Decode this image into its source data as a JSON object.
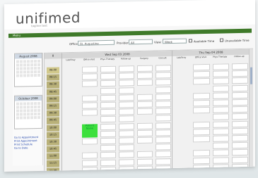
{
  "brand": {
    "name": "unifimed",
    "tagline": "tagline text"
  },
  "nav": {
    "label": "Menu"
  },
  "filters": {
    "office_label": "Office:",
    "office_value": "St. Augustine",
    "provider_label": "Provider:",
    "provider_value": "All",
    "view_label": "View:",
    "view_value": "Week",
    "available_label": "Available Time",
    "unavailable_label": "Unavailable Time"
  },
  "sidebar": {
    "cal1_title": "August 2008",
    "cal2_title": "October 2008",
    "links": [
      "Go to Appointment",
      "Print Appointment",
      "Print Schedule",
      "Go to Date"
    ]
  },
  "schedule": {
    "time_column": {
      "head1": "8",
      "head2": "8"
    },
    "times": [
      "08:00",
      "08:15",
      "08:30",
      "08:45",
      "09:00",
      "09:15",
      "09:30",
      "09:45",
      "10:00",
      "10:15",
      "10:30",
      "10:45",
      "11:00",
      "11:15",
      "11:30"
    ],
    "days": [
      {
        "label": "Wed Sep 03 2008",
        "cols": [
          "Lab/Xray",
          "Office Visit",
          "Phys Therapy",
          "Follow-up",
          "Surgery",
          "Consult"
        ]
      },
      {
        "label": "Thu Sep 04 2008",
        "cols": [
          "Lab/Xray",
          "Office Visit",
          "Phys Therapy",
          "Follow-up"
        ]
      }
    ],
    "appointment": "Patient Name"
  }
}
